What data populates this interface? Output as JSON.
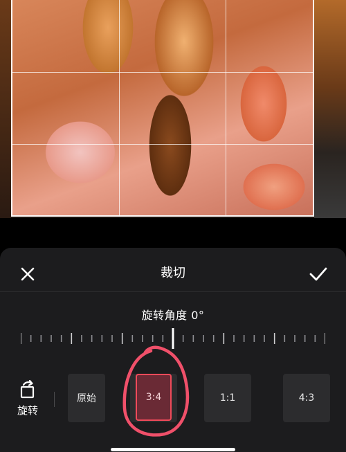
{
  "panel": {
    "title": "裁切",
    "angle_label": "旋转角度 0°"
  },
  "toolbar": {
    "close_icon": "close-icon",
    "confirm_icon": "check-icon"
  },
  "rotate": {
    "label": "旋转",
    "icon": "rotate-icon"
  },
  "ratios": [
    {
      "label": "原始",
      "selected": false
    },
    {
      "label": "3:4",
      "selected": true
    },
    {
      "label": "1:1",
      "selected": false
    },
    {
      "label": "4:3",
      "selected": false
    }
  ],
  "colors": {
    "panel_bg": "#1c1c1e",
    "button_bg": "#2c2c2e",
    "selected_border": "#f04a5a",
    "annotation": "#f0506a"
  }
}
